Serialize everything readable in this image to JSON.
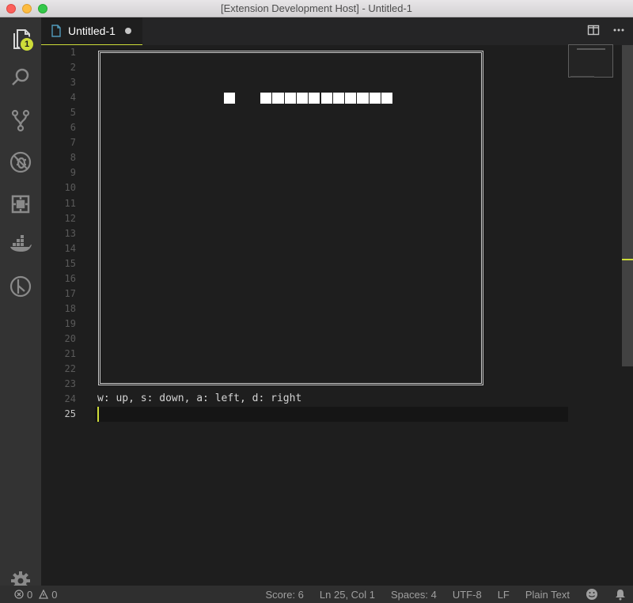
{
  "window": {
    "title": "[Extension Development Host] - Untitled-1"
  },
  "activity_bar": {
    "items": [
      "explorer-icon",
      "search-icon",
      "source-control-icon",
      "debug-icon",
      "extensions-icon",
      "docker-icon",
      "gitlens-icon"
    ],
    "explorer_badge": "1",
    "settings": "gear-icon"
  },
  "tabs": [
    {
      "label": "Untitled-1",
      "dirty": true
    }
  ],
  "editor": {
    "line_numbers": [
      "1",
      "2",
      "3",
      "4",
      "5",
      "6",
      "7",
      "8",
      "9",
      "10",
      "11",
      "12",
      "13",
      "14",
      "15",
      "16",
      "17",
      "18",
      "19",
      "20",
      "21",
      "22",
      "23",
      "24",
      "25"
    ],
    "active_line": 25,
    "hint_text": "w: up, s: down, a: left, d: right",
    "food_cells": 1,
    "snake_cells": 11
  },
  "status_bar": {
    "errors": "0",
    "warnings": "0",
    "score": "Score: 6",
    "position": "Ln 25, Col 1",
    "indent": "Spaces: 4",
    "encoding": "UTF-8",
    "eol": "LF",
    "language": "Plain Text"
  },
  "colors": {
    "accent": "#cddc39",
    "activity_bar": "#333333",
    "editor_bg": "#1e1e1e"
  }
}
